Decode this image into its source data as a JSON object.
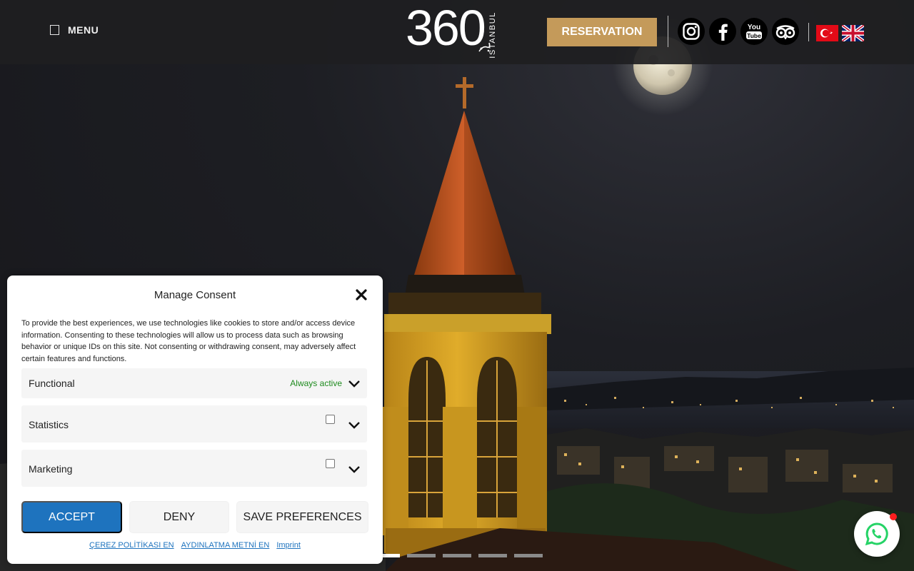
{
  "header": {
    "menu_label": "MENU",
    "logo_number": "360",
    "logo_city": "ISTANBUL",
    "reservation_label": "RESERVATION",
    "social": [
      "instagram-icon",
      "facebook-icon",
      "youtube-icon",
      "tripadvisor-icon"
    ],
    "youtube_text_top": "You",
    "youtube_text_bottom": "Tube",
    "languages": [
      "Turkish",
      "English"
    ]
  },
  "colors": {
    "accent": "#c49a5a",
    "accept_button": "#1e73be",
    "always_active": "#1d8a1d",
    "whatsapp": "#25d366"
  },
  "slider": {
    "total_slides": 5,
    "active_slide": 1
  },
  "consent": {
    "title": "Manage Consent",
    "description": "To provide the best experiences, we use technologies like cookies to store and/or access device information. Consenting to these technologies will allow us to process data such as browsing behavior or unique IDs on this site. Not consenting or withdrawing consent, may adversely affect certain features and functions.",
    "categories": [
      {
        "name": "Functional",
        "status": "Always active"
      },
      {
        "name": "Statistics",
        "status": ""
      },
      {
        "name": "Marketing",
        "status": ""
      }
    ],
    "buttons": {
      "accept": "ACCEPT",
      "deny": "DENY",
      "save": "SAVE PREFERENCES"
    },
    "links": [
      "ÇEREZ POLİTİKASI EN",
      "AYDINLATMA METNİ EN",
      "Imprint"
    ]
  }
}
